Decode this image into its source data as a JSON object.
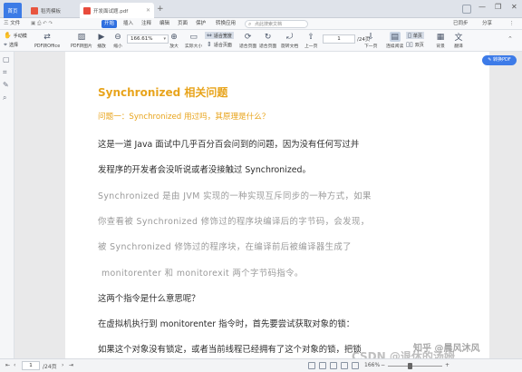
{
  "tabs": {
    "home": "首页",
    "items": [
      {
        "label": "稻壳模板",
        "color": "#e8553f"
      },
      {
        "label": "开发面试题.pdf",
        "color": "#e84b3c"
      }
    ]
  },
  "menu": {
    "file": "三 文件",
    "items": [
      "开始",
      "插入",
      "注释",
      "编辑",
      "页面",
      "保护",
      "转换应用"
    ],
    "active_index": 0,
    "search_placeholder": "点此搜索文档",
    "right": [
      "已同步",
      "分享",
      "⋮"
    ]
  },
  "toolbar": {
    "left_top": "手动模",
    "left_bottom": "选择",
    "buttons": [
      "PDF转Office",
      "PDF转图片",
      "播放",
      "缩小",
      "放大",
      "实际大小",
      "适合页面",
      "旋转文档",
      "上一页",
      "下一页",
      "单页",
      "连续阅读",
      "双页",
      "背景",
      "翻译"
    ],
    "zoom": "166.61%",
    "small1": "适合宽度",
    "small2": "适合页面",
    "small3": "适合宽度",
    "page_current": "1",
    "page_total": "/24页",
    "read_mode": "连续阅读"
  },
  "document": {
    "pdf_button": "转换PDF",
    "heading": "Synchronized 相关问题",
    "question": "问题一：Synchronized 用过吗，其原理是什么？",
    "lines": [
      "这是一道 Java 面试中几乎百分百会问到的问题，因为没有任何写过并",
      "发程序的开发者会没听说或者没接触过 Synchronized。",
      "Synchronized 是由 JVM 实现的一种实现互斥同步的一种方式，如果",
      "你查看被 Synchronized 修饰过的程序块编译后的字节码，会发现，",
      "被 Synchronized 修饰过的程序块，在编译前后被编译器生成了",
      "monitorenter 和 monitorexit 两个字节码指令。",
      "这两个指令是什么意思呢？",
      "在虚拟机执行到 monitorenter 指令时，首先要尝试获取对象的锁：",
      "如果这个对象没有锁定，或者当前线程已经拥有了这个对象的锁，把锁"
    ],
    "watermark_small": "知乎 @晨风沐风",
    "watermark_big": "CSDN @退休的汤姆"
  },
  "status": {
    "page": "1",
    "total": "/24页",
    "zoom": "166%",
    "zoom_minus": "−",
    "zoom_plus": "+"
  }
}
